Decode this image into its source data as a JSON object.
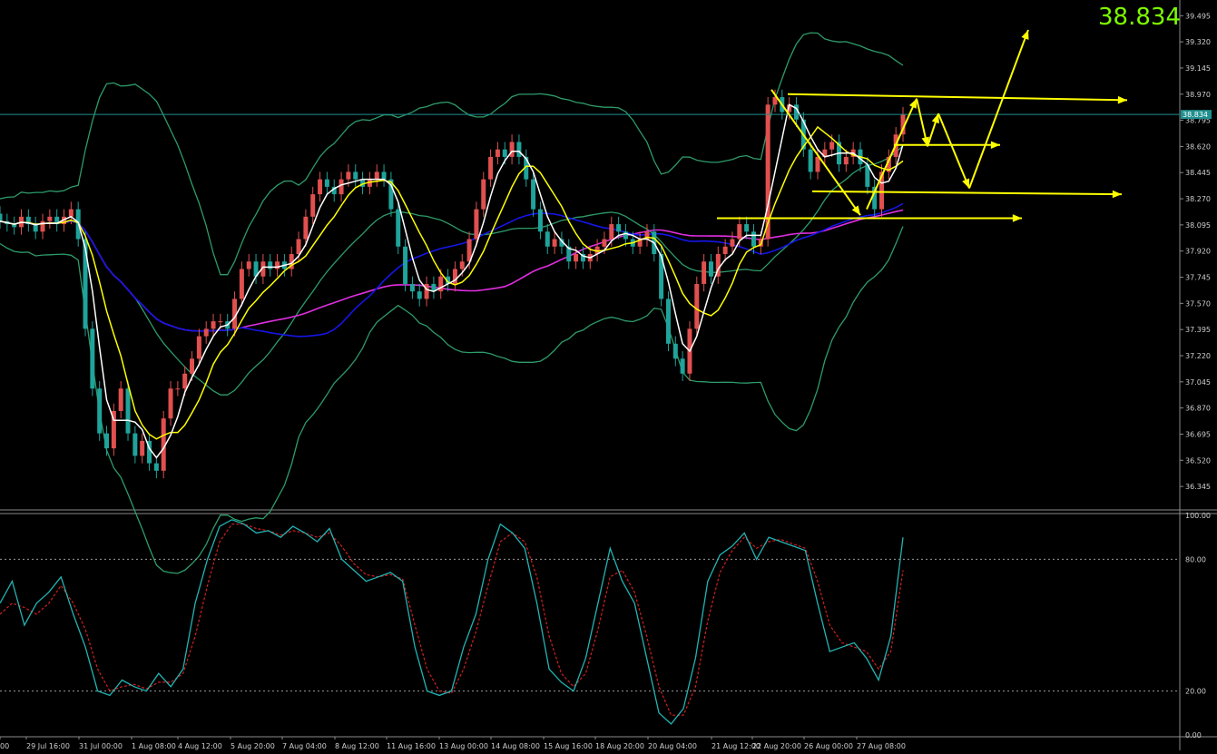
{
  "symbol_price": "38.834",
  "colors": {
    "background": "#000000",
    "bull_candle": "#e0504f",
    "bear_candle": "#1fa39b",
    "bollinger": "#2e9b6a",
    "ma_white": "#ffffff",
    "ma_yellow": "#ffff00",
    "ma_blue": "#1515e6",
    "ma_magenta": "#e02ee0",
    "stoch_main": "#23b3b3",
    "stoch_signal": "#d02020",
    "axis_text": "#cfcfcf",
    "annotation": "#ffff00",
    "price_line": "#1f8f8f"
  },
  "chart_data": [
    {
      "type": "candlestick",
      "title": "",
      "ylim": [
        36.2,
        39.6
      ],
      "current_price": 38.834,
      "y_ticks": [
        "39.495",
        "39.320",
        "39.145",
        "38.970",
        "38.795",
        "38.620",
        "38.445",
        "38.270",
        "38.095",
        "37.920",
        "37.745",
        "37.570",
        "37.395",
        "37.220",
        "37.045",
        "36.870",
        "36.695",
        "36.520",
        "36.345"
      ],
      "x_labels": [
        "00",
        "29 Jul 16:00",
        "31 Jul 00:00",
        "1 Aug 08:00",
        "4 Aug 12:00",
        "5 Aug 20:00",
        "7 Aug 04:00",
        "8 Aug 12:00",
        "11 Aug 16:00",
        "13 Aug 00:00",
        "14 Aug 08:00",
        "15 Aug 16:00",
        "18 Aug 20:00",
        "20 Aug 04:00",
        "21 Aug 12:00",
        "22 Aug 20:00",
        "26 Aug 00:00",
        "27 Aug 08:00"
      ],
      "close": [
        38.12,
        38.1,
        38.08,
        38.15,
        38.1,
        38.05,
        38.12,
        38.15,
        38.1,
        38.15,
        38.2,
        38.0,
        37.4,
        37.0,
        36.7,
        36.6,
        36.85,
        37.0,
        36.7,
        36.55,
        36.65,
        36.5,
        36.45,
        36.8,
        37.0,
        37.0,
        37.1,
        37.2,
        37.35,
        37.4,
        37.45,
        37.45,
        37.4,
        37.6,
        37.8,
        37.85,
        37.75,
        37.85,
        37.8,
        37.85,
        37.8,
        37.9,
        38.0,
        38.15,
        38.3,
        38.4,
        38.35,
        38.3,
        38.4,
        38.45,
        38.4,
        38.35,
        38.4,
        38.45,
        38.4,
        38.2,
        37.95,
        37.7,
        37.65,
        37.6,
        37.7,
        37.65,
        37.75,
        37.7,
        37.8,
        37.85,
        38.0,
        38.2,
        38.4,
        38.55,
        38.6,
        38.55,
        38.65,
        38.55,
        38.4,
        38.2,
        38.05,
        37.95,
        38.0,
        37.95,
        37.85,
        37.9,
        37.85,
        37.9,
        37.95,
        38.0,
        38.1,
        38.05,
        38.0,
        37.95,
        38.0,
        38.05,
        37.9,
        37.6,
        37.3,
        37.2,
        37.1,
        37.4,
        37.7,
        37.85,
        37.75,
        37.9,
        37.95,
        38.0,
        38.1,
        38.05,
        37.95,
        38.0,
        38.9,
        38.95,
        38.85,
        38.9,
        38.8,
        38.6,
        38.45,
        38.55,
        38.6,
        38.65,
        38.5,
        38.55,
        38.6,
        38.5,
        38.35,
        38.2,
        38.45,
        38.55,
        38.7,
        38.834
      ],
      "y_indicator_labels": [
        "100.00",
        "80.00",
        "20.00",
        "0.00"
      ],
      "stoch_levels": [
        80,
        20
      ],
      "stoch_main": [
        60,
        70,
        50,
        60,
        65,
        72,
        55,
        40,
        20,
        18,
        25,
        22,
        20,
        28,
        22,
        30,
        60,
        80,
        95,
        98,
        96,
        92,
        93,
        90,
        95,
        92,
        88,
        94,
        80,
        75,
        70,
        72,
        74,
        70,
        40,
        20,
        18,
        20,
        40,
        55,
        80,
        96,
        92,
        85,
        60,
        30,
        24,
        20,
        35,
        60,
        85,
        70,
        60,
        35,
        10,
        5,
        12,
        35,
        70,
        82,
        86,
        92,
        80,
        90,
        88,
        86,
        84,
        60,
        38,
        40,
        42,
        35,
        25,
        45,
        90
      ],
      "stoch_signal": [
        55,
        60,
        58,
        55,
        60,
        68,
        60,
        48,
        30,
        20,
        22,
        23,
        21,
        24,
        24,
        28,
        45,
        68,
        88,
        96,
        96,
        94,
        93,
        91,
        93,
        92,
        90,
        92,
        86,
        78,
        73,
        72,
        73,
        71,
        50,
        30,
        20,
        19,
        30,
        47,
        68,
        88,
        92,
        88,
        72,
        45,
        28,
        22,
        28,
        48,
        72,
        75,
        65,
        45,
        22,
        9,
        9,
        22,
        52,
        74,
        84,
        90,
        85,
        88,
        89,
        87,
        85,
        70,
        50,
        42,
        40,
        38,
        30,
        38,
        75
      ]
    }
  ]
}
